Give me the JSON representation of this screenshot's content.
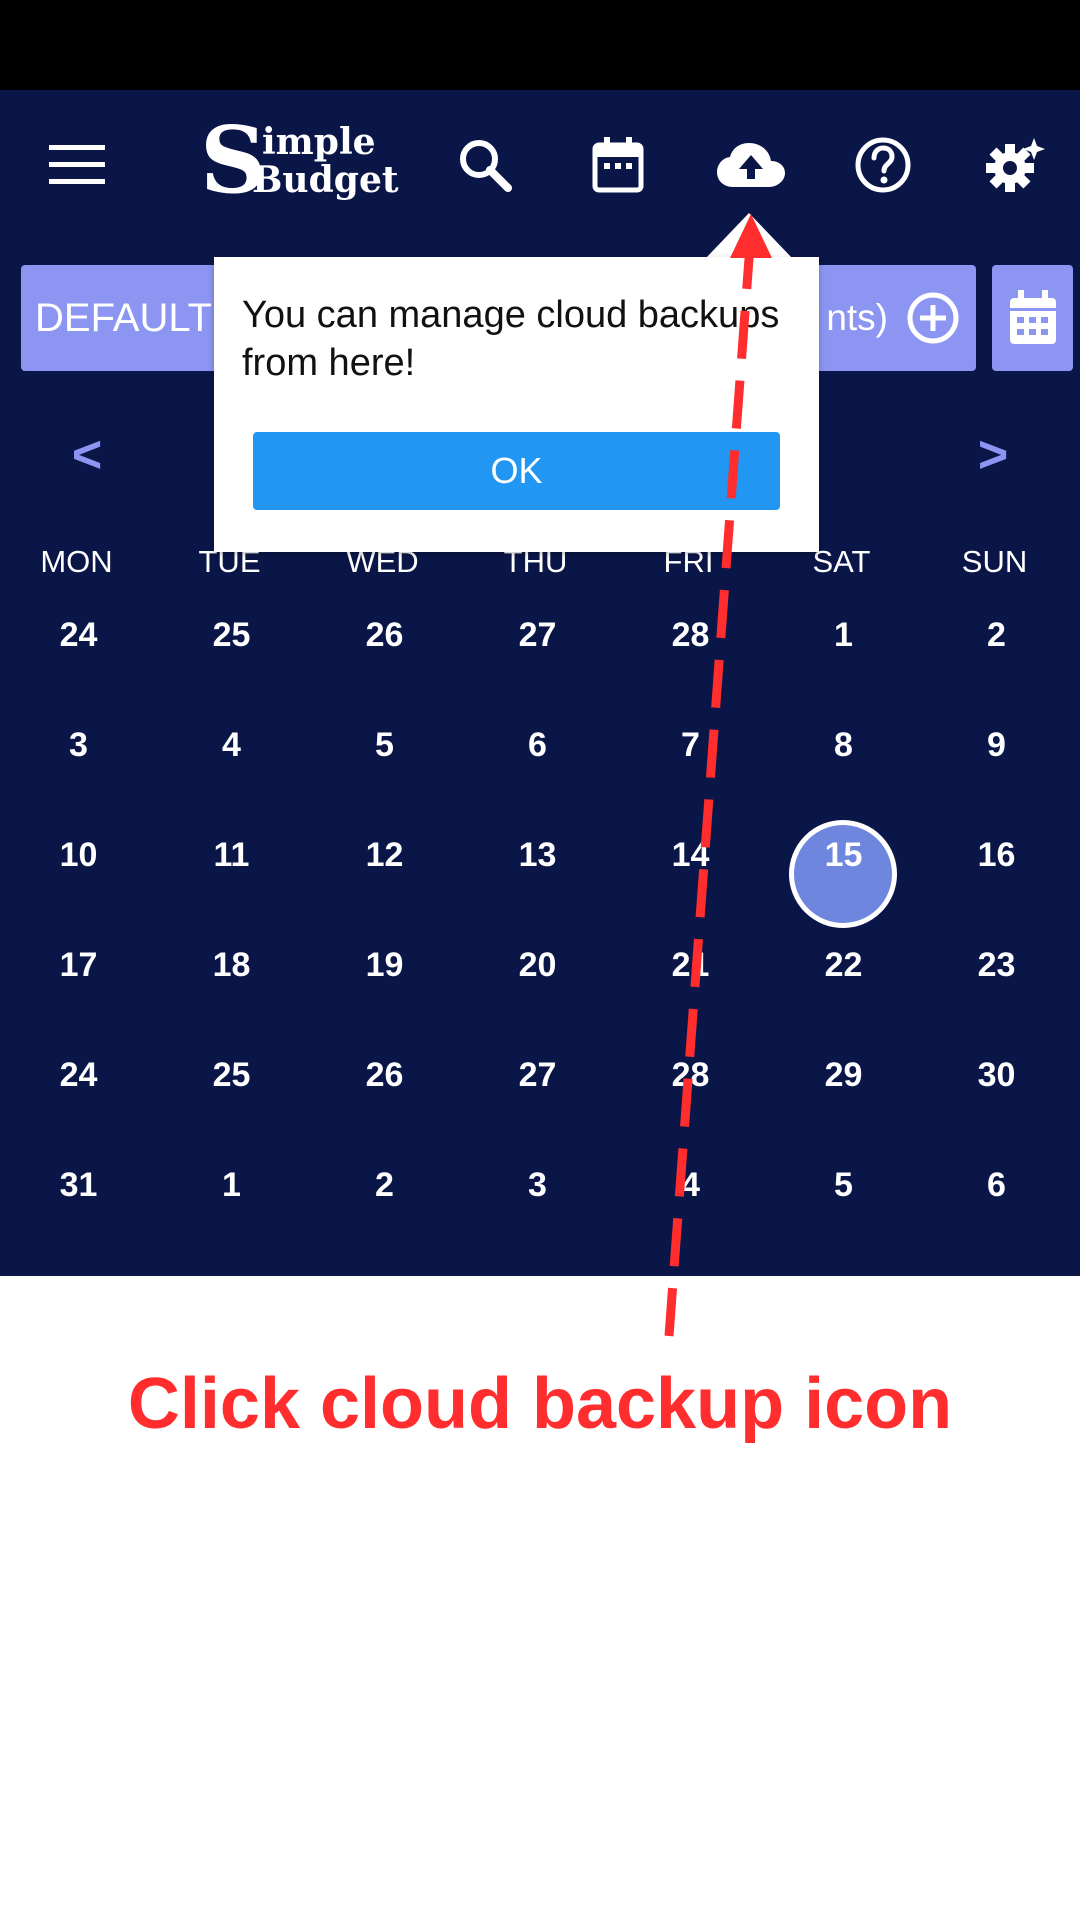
{
  "app_bar": {
    "logo_s": "S",
    "logo_word1": "imple",
    "logo_word2": "Budget",
    "icons": [
      "menu-icon",
      "search-icon",
      "calendar-icon",
      "cloud-upload-icon",
      "help-icon",
      "settings-icon"
    ]
  },
  "budget_bar": {
    "name": "DEFAULT",
    "accounts_text": "nts)"
  },
  "month_nav": {
    "prev": "<",
    "next": ">"
  },
  "calendar": {
    "weekdays": [
      "MON",
      "TUE",
      "WED",
      "THU",
      "FRI",
      "SAT",
      "SUN"
    ],
    "weeks": [
      [
        "24",
        "25",
        "26",
        "27",
        "28",
        "1",
        "2"
      ],
      [
        "3",
        "4",
        "5",
        "6",
        "7",
        "8",
        "9"
      ],
      [
        "10",
        "11",
        "12",
        "13",
        "14",
        "15",
        "16"
      ],
      [
        "17",
        "18",
        "19",
        "20",
        "21",
        "22",
        "23"
      ],
      [
        "24",
        "25",
        "26",
        "27",
        "28",
        "29",
        "30"
      ],
      [
        "31",
        "1",
        "2",
        "3",
        "4",
        "5",
        "6"
      ]
    ],
    "today": "15"
  },
  "tooltip": {
    "message": "You can manage cloud backups from here!",
    "ok_label": "OK"
  },
  "instruction": "Click cloud backup icon",
  "colors": {
    "app_background": "#0b1648",
    "accent_light": "#8c96f2",
    "button_blue": "#2196f3",
    "annotation_red": "#ff2d2d",
    "today_fill": "#6e86de"
  }
}
